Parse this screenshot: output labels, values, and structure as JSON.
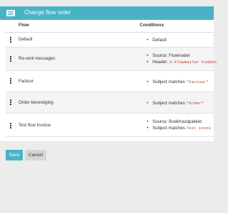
{
  "dialog": {
    "title": "Change flow order",
    "icon": "list-icon"
  },
  "table": {
    "headers": {
      "flow": "Flow",
      "conditions": "Conditions"
    },
    "rows": [
      {
        "flow": "Default",
        "conditions": [
          {
            "text": "Default",
            "code": ""
          }
        ]
      },
      {
        "flow": "Re-sent messages",
        "conditions": [
          {
            "text": "Source: Flowmailer",
            "code": ""
          },
          {
            "text": "Header: ",
            "code": "X-Flowmailer hidden"
          }
        ]
      },
      {
        "flow": "Factuur",
        "conditions": [
          {
            "text": "Subject matches ",
            "code": "*Factuur*"
          }
        ]
      },
      {
        "flow": "Order bevestiging",
        "conditions": [
          {
            "text": "Subject matches ",
            "code": "*Order*"
          }
        ]
      },
      {
        "flow": "Test flow invoice",
        "conditions": [
          {
            "text": "Source: Boekhoudpakket",
            "code": ""
          },
          {
            "text": "Subject matches ",
            "code": "Test invoi"
          }
        ]
      }
    ]
  },
  "buttons": {
    "save": "Save",
    "cancel": "Cancel"
  },
  "colors": {
    "accent": "#49b3c5",
    "code": "#c0392b"
  }
}
